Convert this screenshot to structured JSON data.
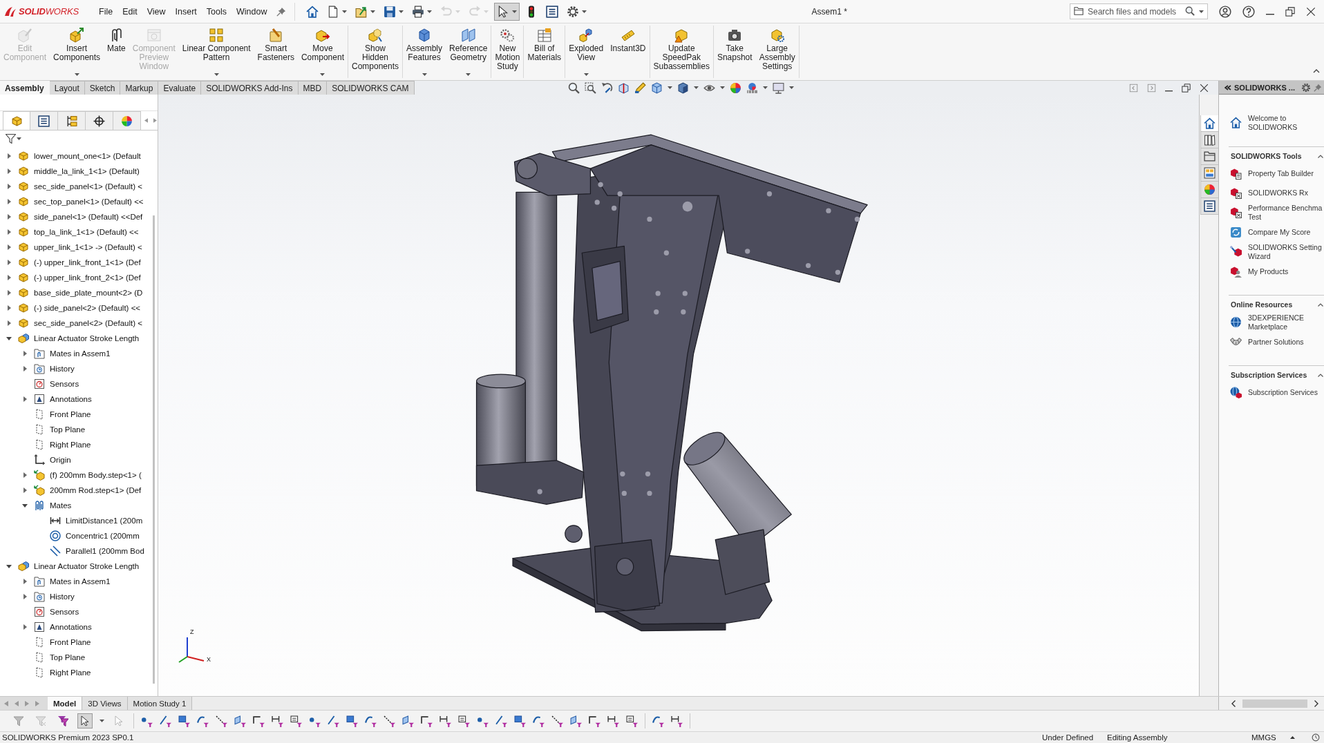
{
  "logo": "**SOLID**WORKS",
  "menu": [
    "File",
    "Edit",
    "View",
    "Insert",
    "Tools",
    "Window"
  ],
  "quick_access": [
    {
      "kind": "home",
      "dropdown": false,
      "disabled": false,
      "pressed": false
    },
    {
      "kind": "new",
      "dropdown": true,
      "disabled": false,
      "pressed": false
    },
    {
      "kind": "open",
      "dropdown": true,
      "disabled": false,
      "pressed": false
    },
    {
      "kind": "save",
      "dropdown": true,
      "disabled": false,
      "pressed": false
    },
    {
      "kind": "print",
      "dropdown": true,
      "disabled": false,
      "pressed": false
    },
    {
      "kind": "undo",
      "dropdown": true,
      "disabled": true,
      "pressed": false
    },
    {
      "kind": "redo",
      "dropdown": true,
      "disabled": true,
      "pressed": false
    },
    {
      "kind": "select",
      "dropdown": true,
      "disabled": false,
      "pressed": true
    },
    {
      "kind": "rebuild",
      "dropdown": false,
      "disabled": false,
      "pressed": false
    },
    {
      "kind": "properties",
      "dropdown": false,
      "disabled": false,
      "pressed": false
    },
    {
      "kind": "options",
      "dropdown": true,
      "disabled": false,
      "pressed": false
    }
  ],
  "document_title": "Assem1 *",
  "search": {
    "placeholder": "Search files and models"
  },
  "ribbon": {
    "groups": [
      {
        "buttons": [
          {
            "kind": "editcomponent",
            "label": "Edit\nComponent",
            "disabled": true,
            "dropdown": false
          },
          {
            "kind": "insertcomponents",
            "label": "Insert\nComponents",
            "disabled": false,
            "dropdown": true
          },
          {
            "kind": "mate",
            "label": "Mate",
            "disabled": false,
            "dropdown": false
          },
          {
            "kind": "preview",
            "label": "Component\nPreview\nWindow",
            "disabled": true,
            "dropdown": false
          },
          {
            "kind": "pattern",
            "label": "Linear Component\nPattern",
            "disabled": false,
            "dropdown": true
          },
          {
            "kind": "fasteners",
            "label": "Smart\nFasteners",
            "disabled": false,
            "dropdown": false
          },
          {
            "kind": "move",
            "label": "Move\nComponent",
            "disabled": false,
            "dropdown": true
          }
        ]
      },
      {
        "buttons": [
          {
            "kind": "showhidden",
            "label": "Show\nHidden\nComponents",
            "disabled": false,
            "dropdown": false
          }
        ]
      },
      {
        "buttons": [
          {
            "kind": "features",
            "label": "Assembly\nFeatures",
            "disabled": false,
            "dropdown": true
          },
          {
            "kind": "refgeometry",
            "label": "Reference\nGeometry",
            "disabled": false,
            "dropdown": true
          }
        ]
      },
      {
        "buttons": [
          {
            "kind": "motion",
            "label": "New\nMotion\nStudy",
            "disabled": false,
            "dropdown": false
          }
        ]
      },
      {
        "buttons": [
          {
            "kind": "bom",
            "label": "Bill of\nMaterials",
            "disabled": false,
            "dropdown": false
          }
        ]
      },
      {
        "buttons": [
          {
            "kind": "exploded",
            "label": "Exploded\nView",
            "disabled": false,
            "dropdown": true
          },
          {
            "kind": "instant3d",
            "label": "Instant3D",
            "disabled": false,
            "dropdown": false
          }
        ]
      },
      {
        "buttons": [
          {
            "kind": "speedpak",
            "label": "Update\nSpeedPak\nSubassemblies",
            "disabled": false,
            "dropdown": false
          }
        ]
      },
      {
        "buttons": [
          {
            "kind": "snapshot",
            "label": "Take\nSnapshot",
            "disabled": false,
            "dropdown": false
          },
          {
            "kind": "largeassembly",
            "label": "Large\nAssembly\nSettings",
            "disabled": false,
            "dropdown": false
          }
        ]
      }
    ]
  },
  "command_tabs": [
    {
      "label": "Assembly",
      "selected": true
    },
    {
      "label": "Layout",
      "selected": false
    },
    {
      "label": "Sketch",
      "selected": false
    },
    {
      "label": "Markup",
      "selected": false
    },
    {
      "label": "Evaluate",
      "selected": false
    },
    {
      "label": "SOLIDWORKS Add-Ins",
      "selected": false
    },
    {
      "label": "MBD",
      "selected": false
    },
    {
      "label": "SOLIDWORKS CAM",
      "selected": false
    }
  ],
  "feature_manager": {
    "tabs": [
      {
        "kind": "tree",
        "selected": true
      },
      {
        "kind": "propertymanager",
        "selected": false
      },
      {
        "kind": "configuration",
        "selected": false
      },
      {
        "kind": "dimxpert",
        "selected": false
      },
      {
        "kind": "display",
        "selected": false
      }
    ],
    "tree": [
      {
        "kind": "part",
        "label": "lower_mount_one<1> (Default",
        "expanded": false
      },
      {
        "kind": "part",
        "label": "middle_la_link_1<1> (Default)",
        "expanded": false
      },
      {
        "kind": "part",
        "label": "sec_side_panel<1> (Default) <",
        "expanded": false
      },
      {
        "kind": "part",
        "label": "sec_top_panel<1> (Default) <<",
        "expanded": false
      },
      {
        "kind": "part",
        "label": "side_panel<1> (Default) <<Def",
        "expanded": false
      },
      {
        "kind": "part",
        "label": "top_la_link_1<1> (Default) <<",
        "expanded": false
      },
      {
        "kind": "part",
        "label": "upper_link_1<1> -> (Default) <",
        "expanded": false
      },
      {
        "kind": "part",
        "label": "(-) upper_link_front_1<1> (Def",
        "expanded": false
      },
      {
        "kind": "part",
        "label": "(-) upper_link_front_2<1> (Def",
        "expanded": false
      },
      {
        "kind": "part",
        "label": "base_side_plate_mount<2> (D",
        "expanded": false
      },
      {
        "kind": "part",
        "label": "(-) side_panel<2> (Default) <<",
        "expanded": false
      },
      {
        "kind": "part",
        "label": "sec_side_panel<2> (Default) <",
        "expanded": false
      },
      {
        "kind": "assembly",
        "label": "Linear Actuator Stroke Length",
        "expanded": true,
        "children": [
          {
            "kind": "matesfolder",
            "label": "Mates in Assem1",
            "expanded": false
          },
          {
            "kind": "history",
            "label": "History",
            "expanded": false
          },
          {
            "kind": "sensors",
            "label": "Sensors"
          },
          {
            "kind": "annotations",
            "label": "Annotations",
            "expanded": false
          },
          {
            "kind": "plane",
            "label": "Front Plane"
          },
          {
            "kind": "plane",
            "label": "Top Plane"
          },
          {
            "kind": "plane",
            "label": "Right Plane"
          },
          {
            "kind": "origin",
            "label": "Origin"
          },
          {
            "kind": "subpart",
            "label": "(f) 200mm Body.step<1> (",
            "expanded": false
          },
          {
            "kind": "subpart",
            "label": "200mm Rod.step<1> (Def",
            "expanded": false
          },
          {
            "kind": "mates",
            "label": "Mates",
            "expanded": true,
            "children": [
              {
                "kind": "limit",
                "label": "LimitDistance1 (200m"
              },
              {
                "kind": "concentric",
                "label": "Concentric1 (200mm"
              },
              {
                "kind": "parallel",
                "label": "Parallel1 (200mm Bod"
              }
            ]
          }
        ]
      },
      {
        "kind": "assembly",
        "label": "Linear Actuator Stroke Length",
        "expanded": true,
        "children": [
          {
            "kind": "matesfolder",
            "label": "Mates in Assem1",
            "expanded": false
          },
          {
            "kind": "history",
            "label": "History",
            "expanded": false
          },
          {
            "kind": "sensors",
            "label": "Sensors"
          },
          {
            "kind": "annotations",
            "label": "Annotations",
            "expanded": false
          },
          {
            "kind": "plane",
            "label": "Front Plane"
          },
          {
            "kind": "plane",
            "label": "Top Plane"
          },
          {
            "kind": "plane",
            "label": "Right Plane"
          }
        ]
      }
    ]
  },
  "viewport": {
    "triad": [
      {
        "label": "Z"
      },
      {
        "label": "X"
      }
    ]
  },
  "task_pane_tabs": [
    {
      "kind": "home",
      "selected": true
    },
    {
      "kind": "library",
      "selected": false
    },
    {
      "kind": "explorer",
      "selected": false
    },
    {
      "kind": "palette",
      "selected": false
    },
    {
      "kind": "appearances",
      "selected": false
    },
    {
      "kind": "customprops",
      "selected": false
    }
  ],
  "task_pane": {
    "title": "SOLIDWORKS ...",
    "welcome": "Welcome to\nSOLIDWORKS",
    "sections": [
      {
        "title": "SOLIDWORKS Tools",
        "expanded": true,
        "items": [
          {
            "kind": "cubedoc",
            "label": "Property Tab Builder"
          },
          {
            "kind": "cuberx",
            "label": "SOLIDWORKS Rx"
          },
          {
            "kind": "cuberx",
            "label": "Performance Benchma\nTest"
          },
          {
            "kind": "swirl",
            "label": "Compare My Score"
          },
          {
            "kind": "wand",
            "label": "SOLIDWORKS Setting\nWizard"
          },
          {
            "kind": "person",
            "label": "My Products"
          }
        ]
      },
      {
        "title": "Online Resources",
        "expanded": true,
        "items": [
          {
            "kind": "globe",
            "label": "3DEXPERIENCE\nMarketplace"
          },
          {
            "kind": "handshake",
            "label": "Partner Solutions"
          }
        ]
      },
      {
        "title": "Subscription Services",
        "expanded": true,
        "items": [
          {
            "kind": "globecube",
            "label": "Subscription Services"
          }
        ]
      }
    ]
  },
  "model_tabs": [
    {
      "label": "Model",
      "selected": true
    },
    {
      "label": "3D Views",
      "selected": false
    },
    {
      "label": "Motion Study 1",
      "selected": false
    }
  ],
  "filter_toolbar": {
    "pointer_pressed": true
  },
  "status_bar": {
    "product": "SOLIDWORKS Premium 2023 SP0.1",
    "fields": [
      "Under Defined",
      "Editing Assembly",
      "MMGS"
    ]
  }
}
